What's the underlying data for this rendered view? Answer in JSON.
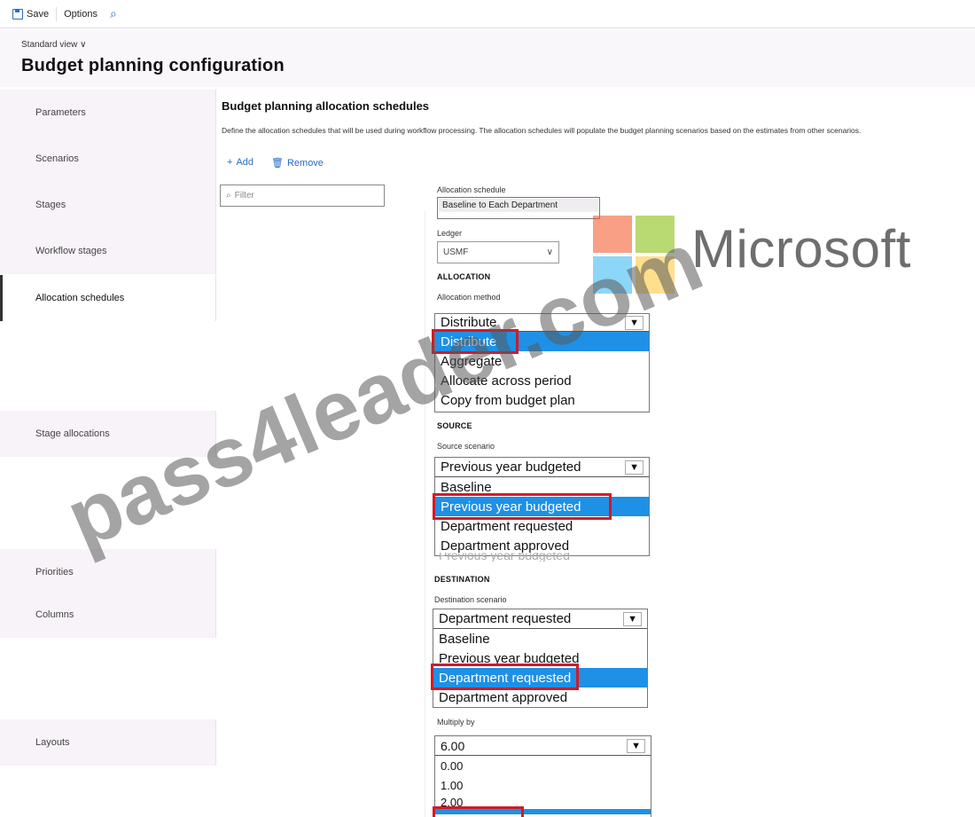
{
  "toolbar": {
    "save_label": "Save",
    "options_label": "Options"
  },
  "header": {
    "view_label": "Standard view",
    "title": "Budget planning configuration"
  },
  "nav": {
    "parameters": "Parameters",
    "scenarios": "Scenarios",
    "stages": "Stages",
    "workflow_stages": "Workflow stages",
    "allocation_schedules": "Allocation schedules",
    "stage_allocations": "Stage allocations",
    "priorities": "Priorities",
    "columns": "Columns",
    "layouts": "Layouts"
  },
  "main": {
    "section_title": "Budget planning allocation schedules",
    "description": "Define the allocation schedules that will be used during workflow processing. The allocation schedules will populate the budget planning scenarios based on the estimates from other scenarios.",
    "add_label": "Add",
    "remove_label": "Remove",
    "filter_placeholder": "Filter"
  },
  "form": {
    "allocation_schedule_label": "Allocation schedule",
    "allocation_schedule_value": "Baseline to Each Department",
    "ledger_label": "Ledger",
    "ledger_value": "USMF",
    "allocation_heading": "ALLOCATION",
    "allocation_method_label": "Allocation method",
    "allocation_method_value": "Distribute",
    "allocation_method_options": [
      "Distribute",
      "Aggregate",
      "Allocate across period",
      "Copy from budget plan"
    ],
    "source_heading": "SOURCE",
    "source_scenario_label": "Source scenario",
    "source_scenario_value": "Previous year budgeted",
    "source_scenario_options": [
      "Baseline",
      "Previous year budgeted",
      "Department requested",
      "Department approved"
    ],
    "source_ghost": "Previous year budgeted",
    "destination_heading": "DESTINATION",
    "destination_scenario_label": "Destination scenario",
    "destination_scenario_value": "Department requested",
    "destination_scenario_options": [
      "Baseline",
      "Previous year budgeted",
      "Department requested",
      "Department approved"
    ],
    "multiply_label": "Multiply by",
    "multiply_value": "6.00",
    "multiply_options": [
      "0.00",
      "1.00",
      "2.00"
    ]
  },
  "overlays": {
    "brand_text": "Microsoft",
    "watermark_text": "pass4leader.com",
    "brand_colors": [
      "#f25022",
      "#7fba00",
      "#00a4ef",
      "#ffb900"
    ]
  }
}
